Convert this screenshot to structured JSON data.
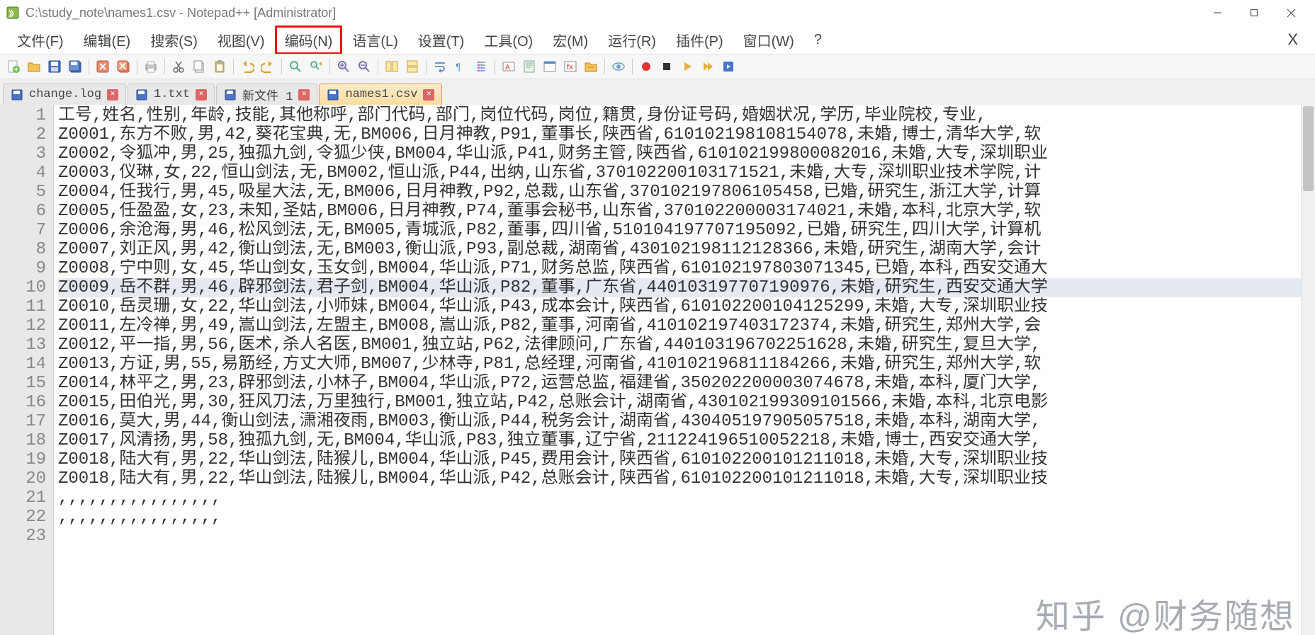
{
  "title": "C:\\study_note\\names1.csv - Notepad++ [Administrator]",
  "menus": {
    "file": "文件(F)",
    "edit": "编辑(E)",
    "search": "搜索(S)",
    "view": "视图(V)",
    "encoding": "编码(N)",
    "language": "语言(L)",
    "settings": "设置(T)",
    "tools": "工具(O)",
    "macro": "宏(M)",
    "run": "运行(R)",
    "plugins": "插件(P)",
    "window": "窗口(W)",
    "help": "?",
    "closedoc": "X"
  },
  "tabs": [
    {
      "label": "change.log",
      "active": false
    },
    {
      "label": "1.txt",
      "active": false
    },
    {
      "label": "新文件 1",
      "active": false
    },
    {
      "label": "names1.csv",
      "active": true
    }
  ],
  "lines": [
    "工号,姓名,性别,年龄,技能,其他称呼,部门代码,部门,岗位代码,岗位,籍贯,身份证号码,婚姻状况,学历,毕业院校,专业,",
    "Z0001,东方不败,男,42,葵花宝典,无,BM006,日月神教,P91,董事长,陕西省,610102198108154078,未婚,博士,清华大学,软",
    "Z0002,令狐冲,男,25,独孤九剑,令狐少侠,BM004,华山派,P41,财务主管,陕西省,610102199800082016,未婚,大专,深圳职业",
    "Z0003,仪琳,女,22,恒山剑法,无,BM002,恒山派,P44,出纳,山东省,370102200103171521,未婚,大专,深圳职业技术学院,计",
    "Z0004,任我行,男,45,吸星大法,无,BM006,日月神教,P92,总裁,山东省,370102197806105458,已婚,研究生,浙江大学,计算",
    "Z0005,任盈盈,女,23,未知,圣姑,BM006,日月神教,P74,董事会秘书,山东省,370102200003174021,未婚,本科,北京大学,软",
    "Z0006,余沧海,男,46,松风剑法,无,BM005,青城派,P82,董事,四川省,510104197707195092,已婚,研究生,四川大学,计算机",
    "Z0007,刘正风,男,42,衡山剑法,无,BM003,衡山派,P93,副总裁,湖南省,430102198112128366,未婚,研究生,湖南大学,会计",
    "Z0008,宁中则,女,45,华山剑女,玉女剑,BM004,华山派,P71,财务总监,陕西省,610102197803071345,已婚,本科,西安交通大",
    "Z0009,岳不群,男,46,辟邪剑法,君子剑,BM004,华山派,P82,董事,广东省,440103197707190976,未婚,研究生,西安交通大学",
    "Z0010,岳灵珊,女,22,华山剑法,小师妹,BM004,华山派,P43,成本会计,陕西省,610102200104125299,未婚,大专,深圳职业技",
    "Z0011,左冷禅,男,49,嵩山剑法,左盟主,BM008,嵩山派,P82,董事,河南省,410102197403172374,未婚,研究生,郑州大学,会",
    "Z0012,平一指,男,56,医术,杀人名医,BM001,独立站,P62,法律顾问,广东省,440103196702251628,未婚,研究生,复旦大学,",
    "Z0013,方证,男,55,易筋经,方丈大师,BM007,少林寺,P81,总经理,河南省,410102196811184266,未婚,研究生,郑州大学,软",
    "Z0014,林平之,男,23,辟邪剑法,小林子,BM004,华山派,P72,运营总监,福建省,350202200003074678,未婚,本科,厦门大学,",
    "Z0015,田伯光,男,30,狂风刀法,万里独行,BM001,独立站,P42,总账会计,湖南省,430102199309101566,未婚,本科,北京电影",
    "Z0016,莫大,男,44,衡山剑法,潇湘夜雨,BM003,衡山派,P44,税务会计,湖南省,430405197905057518,未婚,本科,湖南大学,",
    "Z0017,风清扬,男,58,独孤九剑,无,BM004,华山派,P83,独立董事,辽宁省,211224196510052218,未婚,博士,西安交通大学,",
    "Z0018,陆大有,男,22,华山剑法,陆猴儿,BM004,华山派,P45,费用会计,陕西省,610102200101211018,未婚,大专,深圳职业技",
    "Z0018,陆大有,男,22,华山剑法,陆猴儿,BM004,华山派,P42,总账会计,陕西省,610102200101211018,未婚,大专,深圳职业技",
    ",,,,,,,,,,,,,,,,",
    ",,,,,,,,,,,,,,,,",
    ""
  ],
  "selected_line_index": 9,
  "watermark": "知乎 @财务随想"
}
